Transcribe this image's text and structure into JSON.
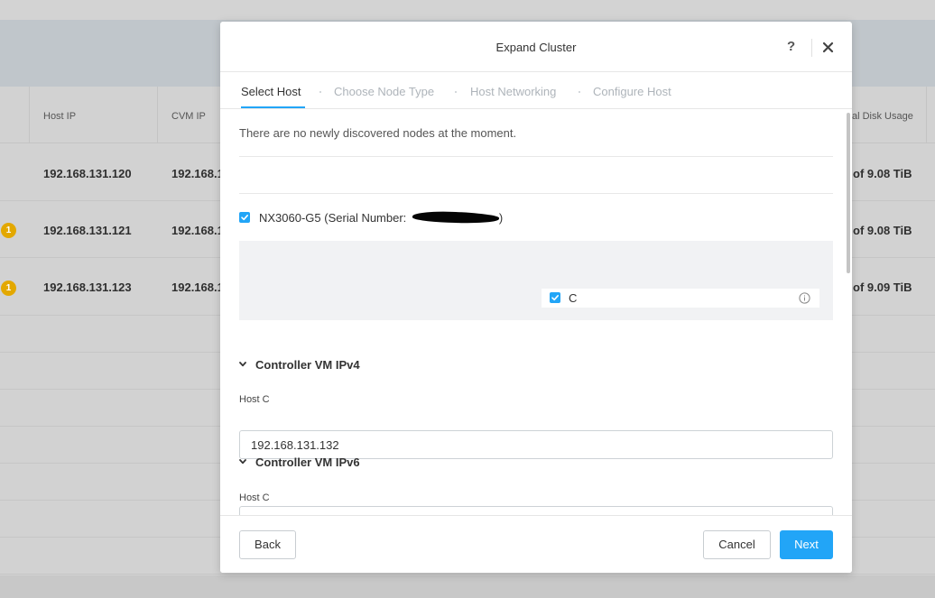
{
  "background": {
    "columns": {
      "host_ip": "Host IP",
      "cvm_ip": "CVM IP",
      "disk_usage": "al Disk Usage"
    },
    "rows": [
      {
        "host_ip": "192.168.131.120",
        "cvm_ip": "192.168.1",
        "disk": "of 9.08 TiB",
        "alert": ""
      },
      {
        "host_ip": "192.168.131.121",
        "cvm_ip": "192.168.1",
        "disk": "of 9.08 TiB",
        "alert": "1"
      },
      {
        "host_ip": "192.168.131.123",
        "cvm_ip": "192.168.1",
        "disk": "of 9.09 TiB",
        "alert": "1"
      }
    ]
  },
  "modal": {
    "title": "Expand Cluster",
    "help_label": "?",
    "steps": [
      {
        "label": "Select Host",
        "active": true
      },
      {
        "label": "Choose Node Type",
        "active": false
      },
      {
        "label": "Host Networking",
        "active": false
      },
      {
        "label": "Configure Host",
        "active": false
      }
    ],
    "no_nodes_message": "There are no newly discovered nodes at the moment.",
    "node": {
      "label_prefix": "NX3060-G5 (Serial Number: ",
      "label_suffix": ")",
      "checked": true,
      "host_label": "C",
      "host_checked": true
    },
    "sections": {
      "ipv4": {
        "title": "Controller VM IPv4",
        "field_label": "Host C",
        "value": "192.168.131.132"
      },
      "ipv6": {
        "title": "Controller VM IPv6",
        "field_label": "Host C",
        "value": ""
      }
    },
    "footer": {
      "back": "Back",
      "cancel": "Cancel",
      "next": "Next"
    }
  },
  "colors": {
    "accent": "#22a5f7",
    "alert": "#e3a800",
    "overlay": "#d0d0d0"
  }
}
